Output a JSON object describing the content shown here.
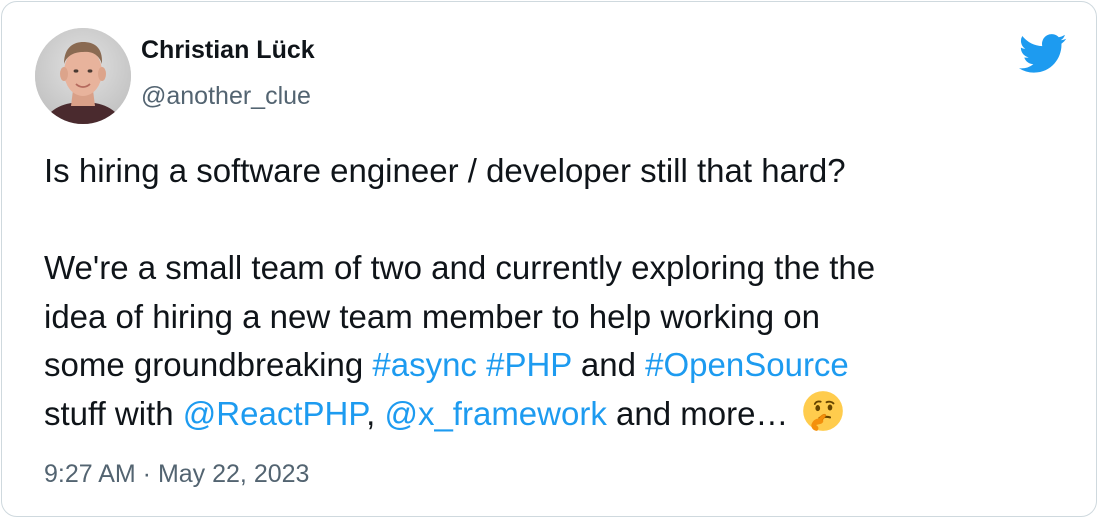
{
  "author": {
    "name": "Christian Lück",
    "handle": "@another_clue"
  },
  "tweet": {
    "line1": "Is hiring a software engineer / developer still that hard?",
    "line2": "We're a small team of two and currently exploring the the",
    "line3": "idea of hiring a new team member to help working on",
    "line4_prefix": "some groundbreaking ",
    "hashtag_async": "#async",
    "space1": " ",
    "hashtag_php": "#PHP",
    "and_text": " and ",
    "hashtag_opensource": "#OpenSource",
    "line5_prefix": "stuff with ",
    "mention_reactphp": "@ReactPHP",
    "comma": ", ",
    "mention_x_framework": "@x_framework",
    "line5_suffix": " and more… ",
    "emoji": "thinking-face-emoji"
  },
  "timestamp": "9:27 AM · May 22, 2023",
  "colors": {
    "accent": "#1d9bf0",
    "text": "#0f1419",
    "secondary_text": "#536471",
    "border": "#cfd9de"
  },
  "icons": {
    "logo": "twitter-bird-icon"
  }
}
